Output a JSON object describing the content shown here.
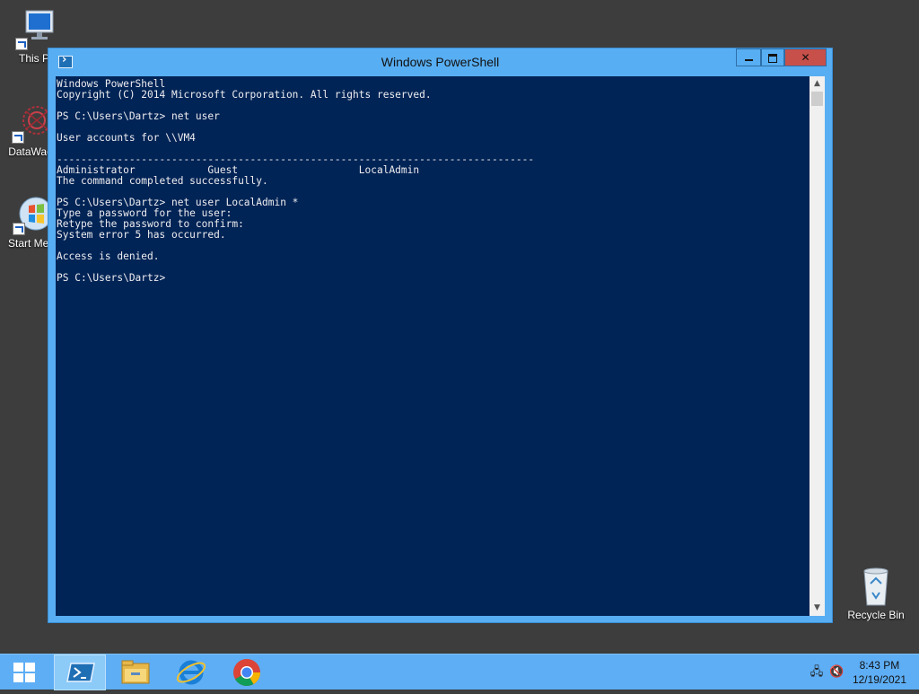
{
  "desktop": {
    "icons": [
      {
        "label": "This P"
      },
      {
        "label": "DataWag"
      },
      {
        "label": "Start Men"
      },
      {
        "label": "Recycle Bin"
      }
    ]
  },
  "window": {
    "title": "Windows PowerShell",
    "console_lines": [
      "Windows PowerShell",
      "Copyright (C) 2014 Microsoft Corporation. All rights reserved.",
      "",
      "PS C:\\Users\\Dartz> net user",
      "",
      "User accounts for \\\\VM4",
      "",
      "-------------------------------------------------------------------------------",
      "Administrator            Guest                    LocalAdmin",
      "The command completed successfully.",
      "",
      "PS C:\\Users\\Dartz> net user LocalAdmin *",
      "Type a password for the user:",
      "Retype the password to confirm:",
      "System error 5 has occurred.",
      "",
      "Access is denied.",
      "",
      "PS C:\\Users\\Dartz>"
    ],
    "console_bg": "#012456",
    "console_fg": "#eeedf0"
  },
  "taskbar": {
    "items": [
      "start-icon",
      "powershell-icon",
      "file-explorer-icon",
      "internet-explorer-icon",
      "chrome-icon"
    ],
    "tray": {
      "time": "8:43 PM",
      "date": "12/19/2021"
    },
    "color": "#5eaef5"
  }
}
